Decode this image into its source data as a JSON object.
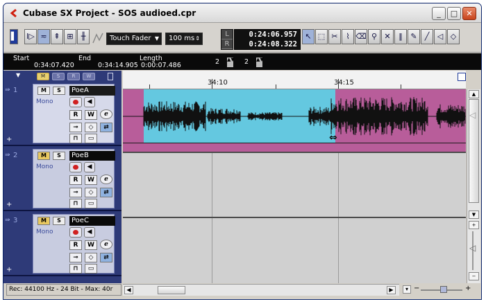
{
  "window": {
    "title": "Cubase SX Project - SOS audioed.cpr",
    "minimize": "_",
    "maximize": "□",
    "close": "✕"
  },
  "toolbar": {
    "automation_mode": "Touch Fader",
    "preroll": "100 ms",
    "locator_left_label": "L",
    "locator_right_label": "R",
    "locator_left_time": "0:24:06.957",
    "locator_right_time": "0:24:08.322",
    "tools": [
      "object-selection",
      "range-selection",
      "split",
      "glue",
      "erase",
      "zoom",
      "mute",
      "time-warp",
      "draw",
      "line",
      "play",
      "color"
    ]
  },
  "infoline": {
    "start_label": "Start",
    "start_value": "0:34:07.420",
    "end_label": "End",
    "end_value": "0:34:14.905",
    "length_label": "Length",
    "length_value": "0:00:07.486",
    "field_a": "2",
    "field_b": "2"
  },
  "header": {
    "buttons": [
      "M",
      "S",
      "R",
      "W"
    ]
  },
  "ruler": {
    "labels": [
      "34:10",
      "34:15"
    ]
  },
  "tracks": [
    {
      "number": "1",
      "name": "PoeA",
      "mode": "Mono",
      "selected": true
    },
    {
      "number": "2",
      "name": "PoeB",
      "mode": "Mono",
      "selected": false
    },
    {
      "number": "3",
      "name": "PoeC",
      "mode": "Mono",
      "selected": false
    }
  ],
  "track_buttons": {
    "mute": "M",
    "solo": "S",
    "read": "R",
    "write": "W",
    "edit": "e"
  },
  "status": {
    "text": "Rec: 44100 Hz - 24 Bit - Max: 40r"
  },
  "colors": {
    "event_pink": "#b85d9a",
    "event_selected_blue": "#64c8e0",
    "tracklist_bg": "#2e3a78"
  }
}
